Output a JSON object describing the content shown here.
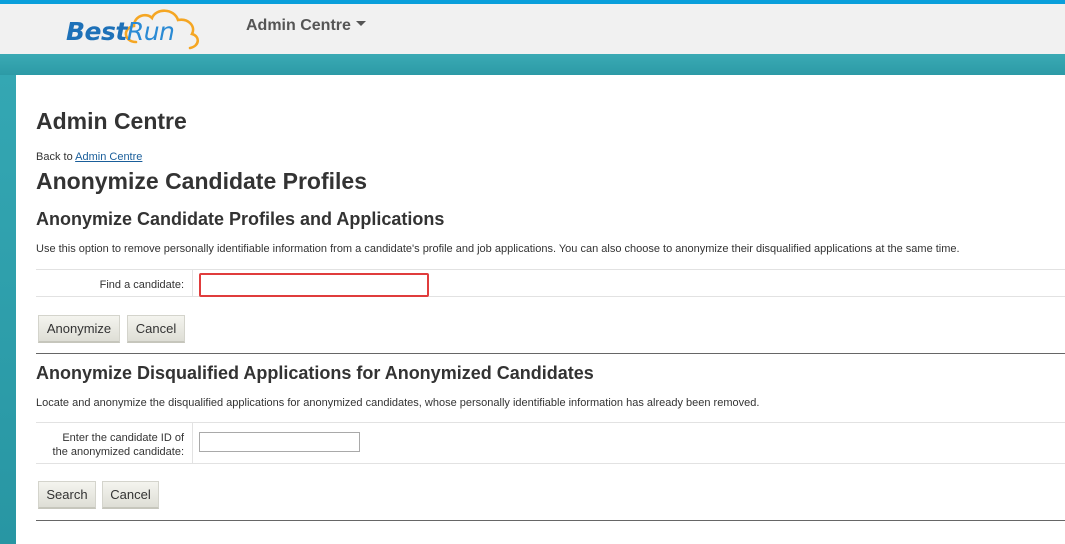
{
  "header": {
    "logo_part1": "Best",
    "logo_part2": "Run",
    "nav_menu_label": "Admin Centre"
  },
  "colors": {
    "brand_blue": "#1e71b8",
    "teal_accent": "#2c9aa6",
    "highlight_red": "#e03c3c"
  },
  "page": {
    "title": "Admin Centre",
    "back_prefix": "Back to",
    "back_link": "Admin Centre",
    "subtitle": "Anonymize Candidate Profiles"
  },
  "section1": {
    "title": "Anonymize Candidate Profiles and Applications",
    "description": "Use this option to remove personally identifiable information from a candidate's profile and job applications. You can also choose to anonymize their disqualified applications at the same time.",
    "find_label": "Find a candidate:",
    "find_value": "",
    "anonymize_label": "Anonymize",
    "cancel_label": "Cancel"
  },
  "section2": {
    "title": "Anonymize Disqualified Applications for Anonymized Candidates",
    "description": "Locate and anonymize the disqualified applications for anonymized candidates, whose personally identifiable information has already been removed.",
    "id_label_line1": "Enter the candidate ID of",
    "id_label_line2": "the anonymized candidate:",
    "id_value": "",
    "search_label": "Search",
    "cancel_label": "Cancel"
  }
}
